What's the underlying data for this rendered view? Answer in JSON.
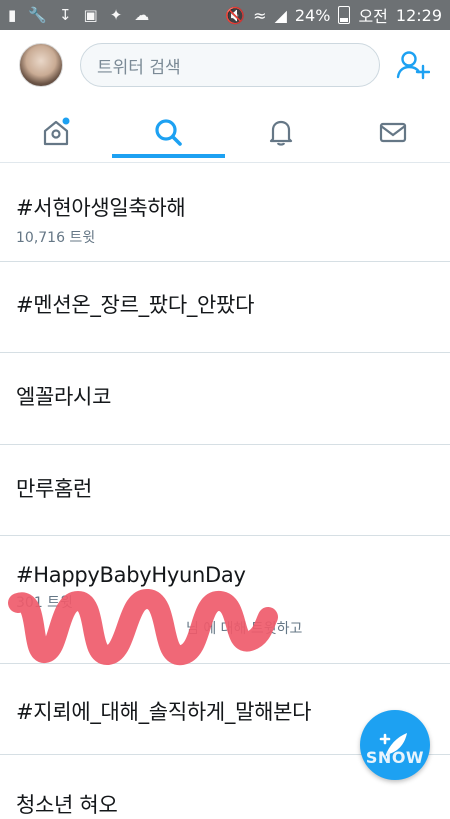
{
  "status_bar": {
    "icons": [
      "chat-icon",
      "wrench-icon",
      "download-icon",
      "image-icon",
      "twitter-bird-icon",
      "cloud-icon",
      "mute-icon",
      "wifi-icon",
      "signal-icon",
      "battery-icon"
    ],
    "battery": "24%",
    "time_label": "오전",
    "time": "12:29"
  },
  "header": {
    "search_placeholder": "트위터 검색",
    "tabs": [
      "home-icon",
      "search-icon",
      "notifications-icon",
      "messages-icon"
    ],
    "active_tab": 1,
    "accent_color": "#1da1f2"
  },
  "trends": [
    {
      "title": "#서현아생일축하해",
      "sub": "10,716 트윗"
    },
    {
      "title": "#멘션온_장르_팠다_안팠다",
      "sub": ""
    },
    {
      "title": "엘꼴라시코",
      "sub": ""
    },
    {
      "title": "만루홈런",
      "sub": ""
    },
    {
      "title": "#HappyBabyHyunDay",
      "sub": "301 트윗",
      "desc": "님 에 대해 트윗하고"
    },
    {
      "title": "#지뢰에_대해_솔직하게_말해본다",
      "sub": ""
    },
    {
      "title": "청소년 혀오",
      "sub": ""
    }
  ],
  "watermark": "SNOW"
}
